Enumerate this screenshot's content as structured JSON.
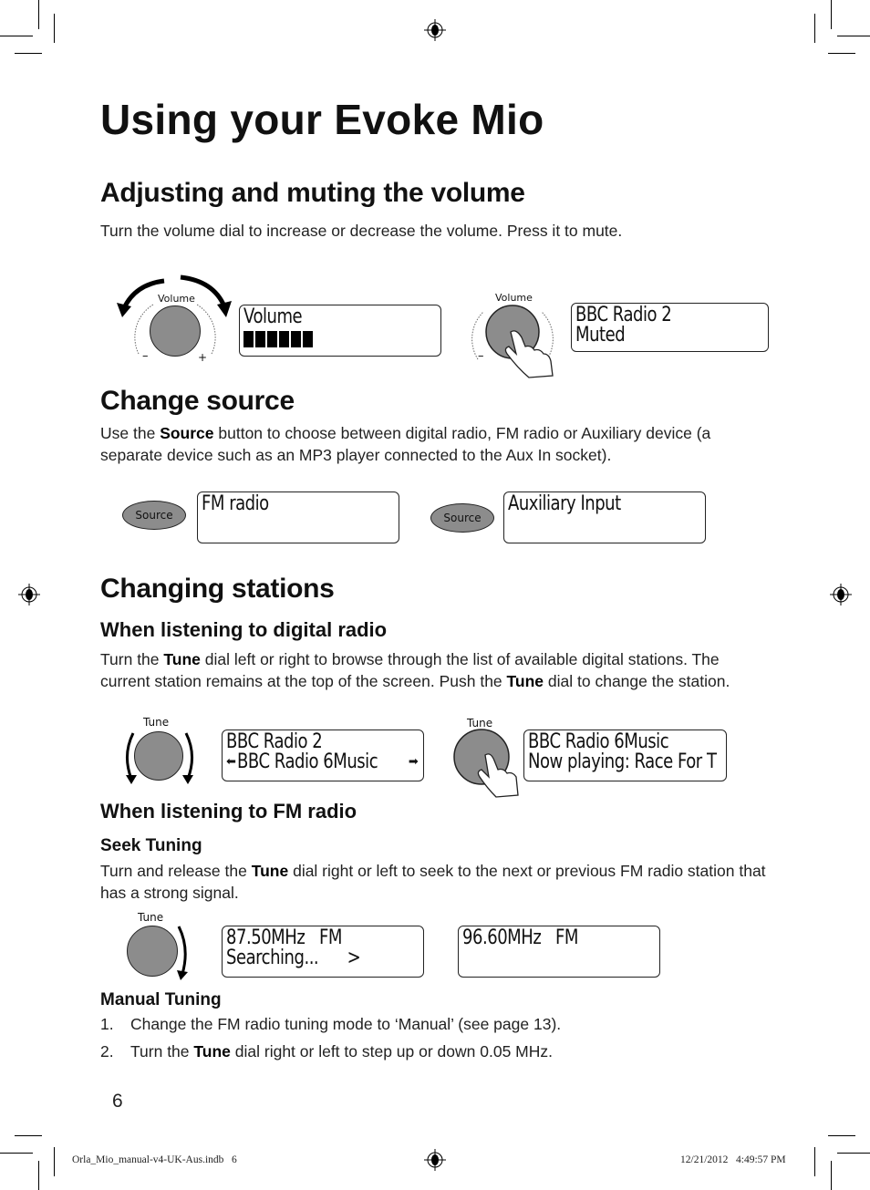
{
  "page": {
    "title": "Using your Evoke Mio",
    "page_number": "6"
  },
  "volume_section": {
    "heading": "Adjusting and muting the volume",
    "body": "Turn the volume dial to increase or decrease the volume. Press it to mute.",
    "knob_label": "Volume",
    "minus": "–",
    "plus": "+",
    "display1": {
      "line1": "Volume",
      "level_bars": 6
    },
    "display2": {
      "line1": "BBC Radio 2",
      "line2": "Muted"
    }
  },
  "source_section": {
    "heading": "Change source",
    "body_pre": "Use the ",
    "body_bold": "Source",
    "body_post": " button to choose between digital radio, FM radio or Auxiliary device (a separate device such as an MP3 player connected to the Aux In socket).",
    "button_label": "Source",
    "display1": {
      "line1": "FM radio"
    },
    "display2": {
      "line1": "Auxiliary Input"
    }
  },
  "stations_section": {
    "heading": "Changing stations",
    "digital": {
      "subheading": "When listening to digital radio",
      "body_1": "Turn the ",
      "body_b1": "Tune",
      "body_2": " dial left or right to browse through the list of available digital stations. The current station remains at the top of the screen. Push the ",
      "body_b2": "Tune",
      "body_3": " dial to change the station.",
      "knob_label": "Tune",
      "display1": {
        "line1": "BBC Radio 2",
        "line2": "BBC Radio 6Music"
      },
      "display2": {
        "line1": "BBC Radio 6Music",
        "line2": "Now playing: Race For T"
      }
    },
    "fm": {
      "subheading": "When listening to FM radio",
      "seek_heading": "Seek Tuning",
      "seek_1": "Turn and release the ",
      "seek_b": "Tune",
      "seek_2": " dial right or left to seek to the next or previous FM radio station that has a strong signal.",
      "knob_label": "Tune",
      "display1": {
        "line1": "87.50MHz   FM",
        "line2": "Searching...      >"
      },
      "display2": {
        "line1": "96.60MHz   FM"
      },
      "manual_heading": "Manual Tuning",
      "steps": [
        {
          "num": "1.",
          "pre": "Change the FM radio tuning mode to ‘Manual’ (see page 13).",
          "bold": "",
          "post": ""
        },
        {
          "num": "2.",
          "pre": "Turn the ",
          "bold": "Tune",
          "post": " dial right or left to step up or down 0.05 MHz."
        }
      ]
    }
  },
  "footer": {
    "file": "Orla_Mio_manual-v4-UK-Aus.indb   6",
    "timestamp": "12/21/2012   4:49:57 PM"
  }
}
